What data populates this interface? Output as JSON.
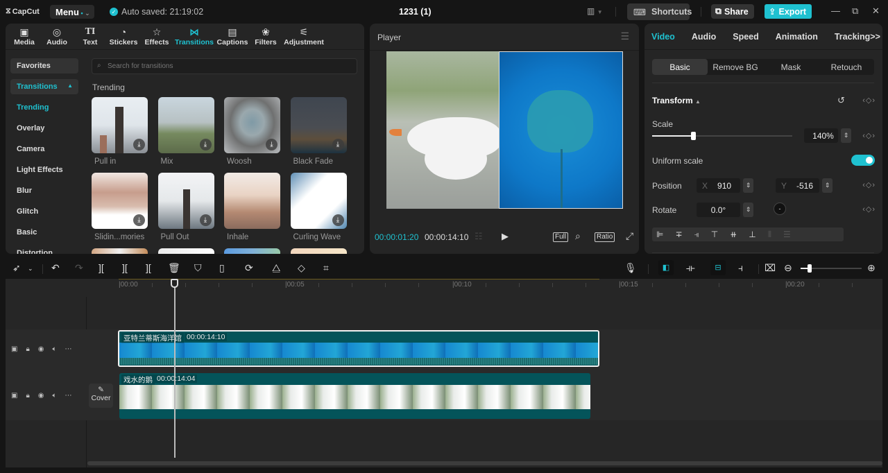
{
  "titlebar": {
    "app_name": "CapCut",
    "menu_label": "Menu",
    "autosave_text": "Auto saved: 21:19:02",
    "project_title": "1231 (1)",
    "shortcuts_label": "Shortcuts",
    "share_label": "Share",
    "export_label": "Export",
    "accent_color": "#1fc1d0"
  },
  "tool_tabs": [
    {
      "label": "Media",
      "icon": "media-icon",
      "active": false
    },
    {
      "label": "Audio",
      "icon": "audio-icon",
      "active": false
    },
    {
      "label": "Text",
      "icon": "text-icon",
      "active": false
    },
    {
      "label": "Stickers",
      "icon": "stickers-icon",
      "active": false
    },
    {
      "label": "Effects",
      "icon": "effects-icon",
      "active": false
    },
    {
      "label": "Transitions",
      "icon": "transitions-icon",
      "active": true
    },
    {
      "label": "Captions",
      "icon": "captions-icon",
      "active": false
    },
    {
      "label": "Filters",
      "icon": "filters-icon",
      "active": false
    },
    {
      "label": "Adjustment",
      "icon": "adjustment-icon",
      "active": false
    }
  ],
  "categories": {
    "favorites": "Favorites",
    "transitions": "Transitions",
    "items": [
      "Trending",
      "Overlay",
      "Camera",
      "Light Effects",
      "Blur",
      "Glitch",
      "Basic",
      "Distortion"
    ]
  },
  "search": {
    "placeholder": "Search for transitions"
  },
  "section_title": "Trending",
  "transitions": [
    {
      "label": "Pull in"
    },
    {
      "label": "Mix"
    },
    {
      "label": "Woosh"
    },
    {
      "label": "Black Fade"
    },
    {
      "label": "Slidin...mories"
    },
    {
      "label": "Pull Out"
    },
    {
      "label": "Inhale"
    },
    {
      "label": "Curling Wave"
    }
  ],
  "player": {
    "title": "Player",
    "current_time": "00:00:01:20",
    "duration": "00:00:14:10",
    "full_label": "Full",
    "ratio_label": "Ratio"
  },
  "props": {
    "tabs": [
      "Video",
      "Audio",
      "Speed",
      "Animation",
      "Tracking>>"
    ],
    "active_tab": "Video",
    "subtabs": [
      "Basic",
      "Remove BG",
      "Mask",
      "Retouch"
    ],
    "active_subtab": "Basic",
    "transform_label": "Transform",
    "scale_label": "Scale",
    "scale_value": "140%",
    "scale_fraction": 0.29,
    "uniform_scale_label": "Uniform scale",
    "uniform_scale_on": true,
    "position_label": "Position",
    "pos_x_label": "X",
    "pos_x": "910",
    "pos_y_label": "Y",
    "pos_y": "-516",
    "rotate_label": "Rotate",
    "rotate_value": "0.0°"
  },
  "timeline": {
    "ruler_labels": [
      "00:00",
      "00:05",
      "00:10",
      "00:15",
      "00:20"
    ],
    "zoom_fraction": 0.15,
    "tracks": [
      {
        "clip_name": "亚特兰蒂斯海洋馆",
        "clip_duration": "00:00:14:10",
        "selected": true
      },
      {
        "clip_name": "戏水的鹅",
        "clip_duration": "00:00:14:04",
        "selected": false
      }
    ],
    "cover_label": "Cover"
  }
}
